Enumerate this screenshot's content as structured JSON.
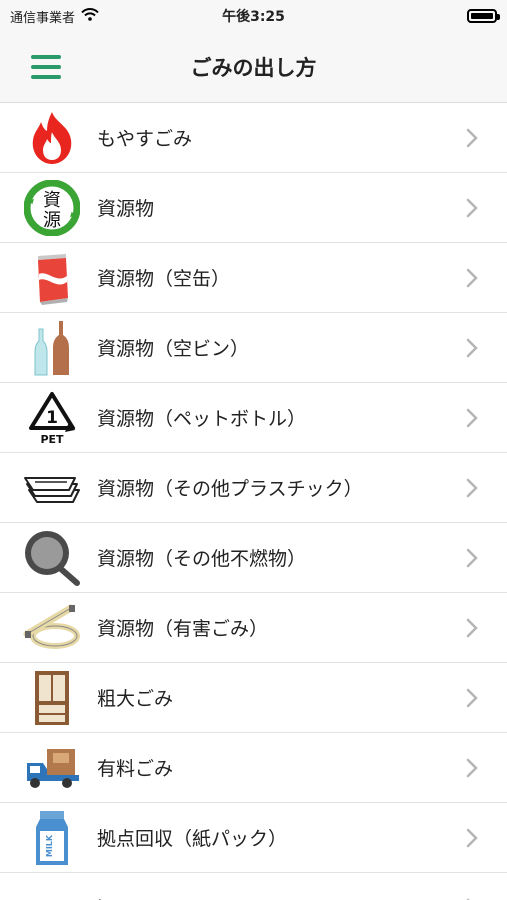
{
  "status_bar": {
    "carrier": "通信事業者",
    "time": "午後3:25"
  },
  "nav": {
    "title": "ごみの出し方",
    "menu_icon": "hamburger-menu-icon",
    "accent_color": "#2a9a6b"
  },
  "items": [
    {
      "label": "もやすごみ",
      "icon": "flame-icon"
    },
    {
      "label": "資源物",
      "icon": "recycle-resource-icon",
      "icon_text_top": "資",
      "icon_text_bottom": "源"
    },
    {
      "label": "資源物（空缶）",
      "icon": "can-icon"
    },
    {
      "label": "資源物（空ビン）",
      "icon": "bottles-icon"
    },
    {
      "label": "資源物（ペットボトル）",
      "icon": "pet-recycle-icon",
      "icon_text": "PET",
      "icon_number": "1"
    },
    {
      "label": "資源物（その他プラスチック）",
      "icon": "plastic-trays-icon"
    },
    {
      "label": "資源物（その他不燃物）",
      "icon": "frying-pan-icon"
    },
    {
      "label": "資源物（有害ごみ）",
      "icon": "fluorescent-lamp-icon"
    },
    {
      "label": "粗大ごみ",
      "icon": "cabinet-icon"
    },
    {
      "label": "有料ごみ",
      "icon": "truck-icon"
    },
    {
      "label": "拠点回収（紙パック）",
      "icon": "milk-carton-icon",
      "icon_text": "MILK"
    },
    {
      "label": "泥",
      "icon": "mud-icon"
    }
  ]
}
